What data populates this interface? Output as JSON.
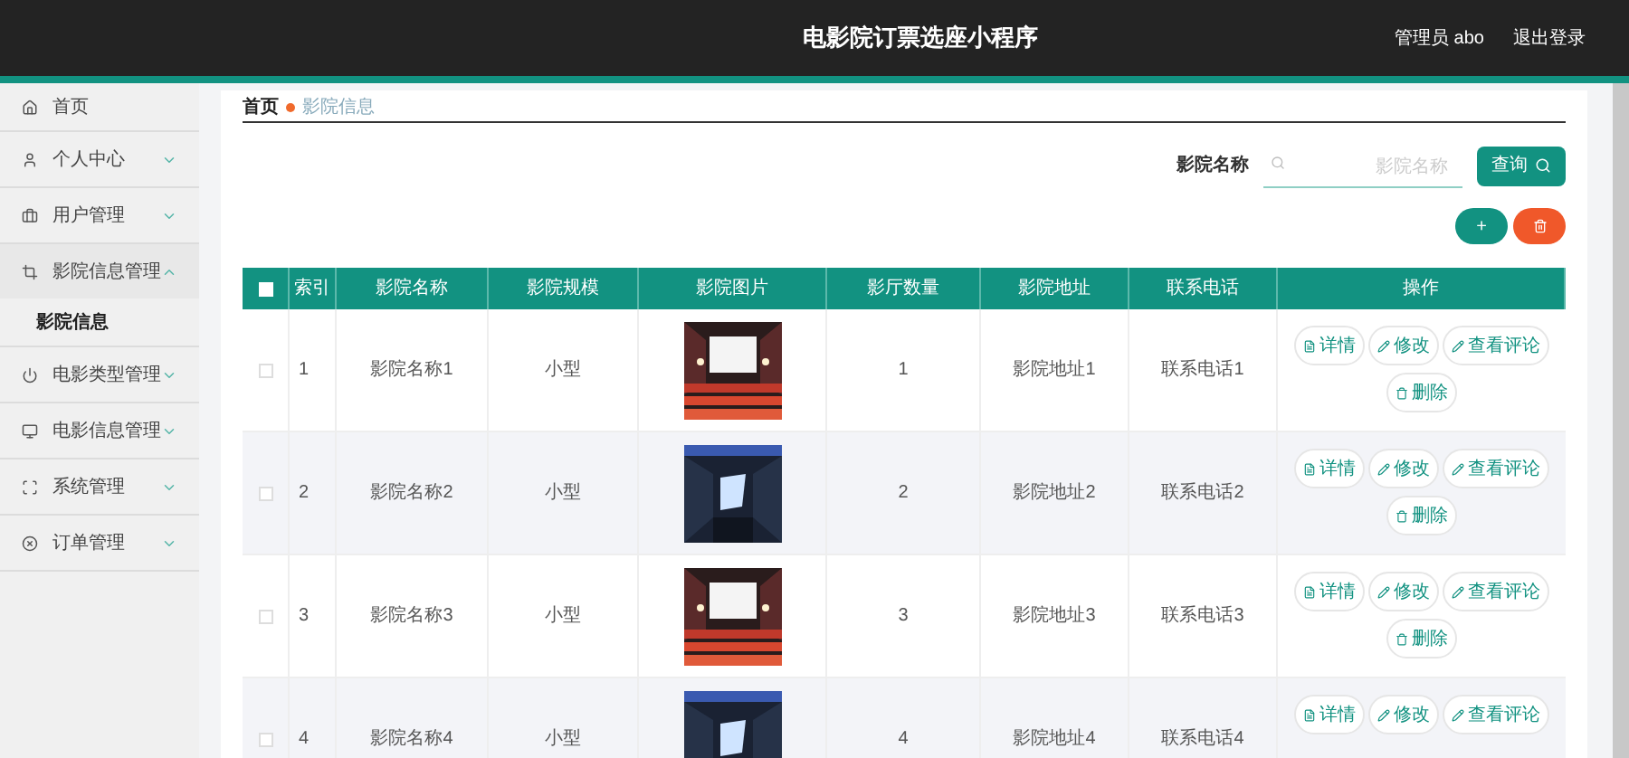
{
  "header": {
    "title": "电影院订票选座小程序",
    "user": "管理员 abo",
    "logout": "退出登录"
  },
  "sidebar": [
    {
      "kind": "link",
      "label": "首页"
    },
    {
      "kind": "group",
      "label": "个人中心",
      "expanded": false
    },
    {
      "kind": "group",
      "label": "用户管理",
      "expanded": false
    },
    {
      "kind": "group",
      "label": "影院信息管理",
      "expanded": true,
      "children": [
        {
          "label": "影院信息",
          "selected": true
        }
      ]
    },
    {
      "kind": "group",
      "label": "电影类型管理",
      "expanded": false
    },
    {
      "kind": "group",
      "label": "电影信息管理",
      "expanded": false
    },
    {
      "kind": "group",
      "label": "系统管理",
      "expanded": false
    },
    {
      "kind": "group",
      "label": "订单管理",
      "expanded": false
    }
  ],
  "breadcrumb": [
    "首页",
    "影院信息"
  ],
  "search": {
    "label": "影院名称",
    "placeholder": "影院名称",
    "button": "查询"
  },
  "add_button": "+",
  "table": {
    "select_all_checked": false,
    "columns": [
      "索引",
      "影院名称",
      "影院规模",
      "影院图片",
      "影厅数量",
      "影院地址",
      "联系电话",
      "操作"
    ],
    "rows": [
      {
        "checked": false,
        "index": "1",
        "name": "影院名称1",
        "scale": "小型",
        "count": "1",
        "address": "影院地址1",
        "phone": "联系电话1",
        "actions": [
          "详情",
          "修改",
          "查看评论",
          "删除"
        ]
      },
      {
        "checked": false,
        "index": "2",
        "name": "影院名称2",
        "scale": "小型",
        "count": "2",
        "address": "影院地址2",
        "phone": "联系电话2",
        "actions": [
          "详情",
          "修改",
          "查看评论",
          "删除"
        ]
      },
      {
        "checked": false,
        "index": "3",
        "name": "影院名称3",
        "scale": "小型",
        "count": "3",
        "address": "影院地址3",
        "phone": "联系电话3",
        "actions": [
          "详情",
          "修改",
          "查看评论",
          "删除"
        ]
      },
      {
        "checked": false,
        "index": "4",
        "name": "影院名称4",
        "scale": "小型",
        "count": "4",
        "address": "影院地址4",
        "phone": "联系电话4",
        "actions": [
          "详情",
          "修改",
          "查看评论"
        ]
      }
    ]
  }
}
